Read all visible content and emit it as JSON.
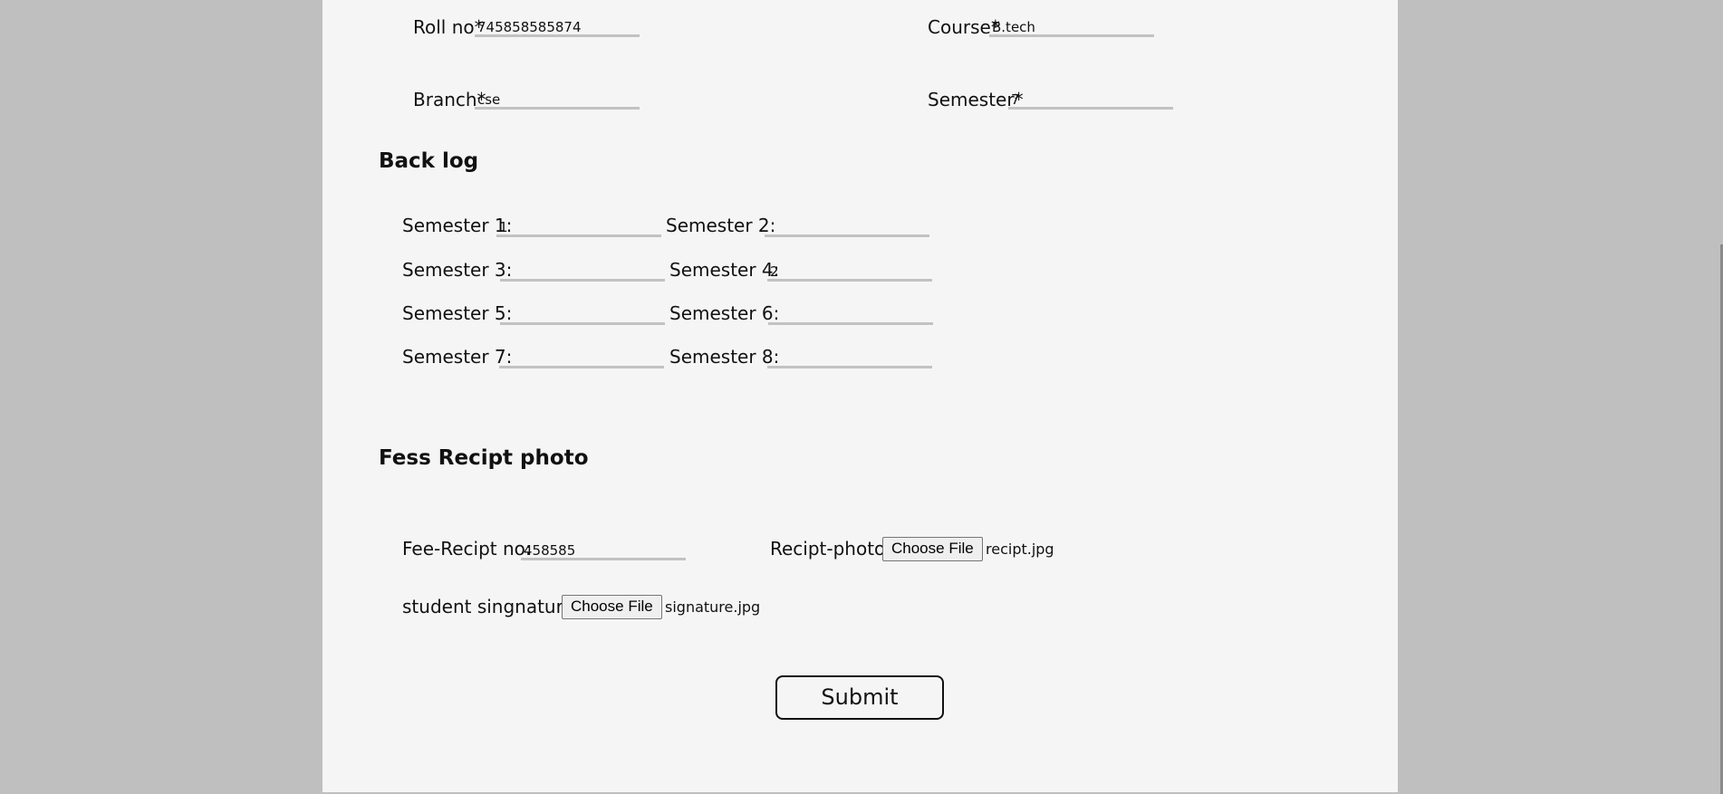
{
  "student": {
    "roll_label": "Roll no*",
    "roll_value": "745858585874",
    "course_label": "Course*",
    "course_value": "B.tech",
    "branch_label": "Branch*",
    "branch_value": "cse",
    "semester_label": "Semester*",
    "semester_value": "7"
  },
  "backlog": {
    "heading": "Back log",
    "items": [
      {
        "label": "Semester 1:",
        "value": "1"
      },
      {
        "label": "Semester 2:",
        "value": ""
      },
      {
        "label": "Semester 3:",
        "value": ""
      },
      {
        "label": "Semester 4:",
        "value": "2"
      },
      {
        "label": "Semester 5:",
        "value": ""
      },
      {
        "label": "Semester 6:",
        "value": ""
      },
      {
        "label": "Semester 7:",
        "value": ""
      },
      {
        "label": "Semester 8:",
        "value": ""
      }
    ]
  },
  "fees": {
    "heading": "Fess Recipt photo",
    "recipt_no_label": "Fee-Recipt no:",
    "recipt_no_value": "458585",
    "recipt_photo_label": "Recipt-photo:",
    "recipt_photo_button": "Choose File",
    "recipt_photo_file": "recipt.jpg",
    "signature_label": "student singnature:",
    "signature_button": "Choose File",
    "signature_file": "signature.jpg"
  },
  "form": {
    "submit_label": "Submit"
  }
}
